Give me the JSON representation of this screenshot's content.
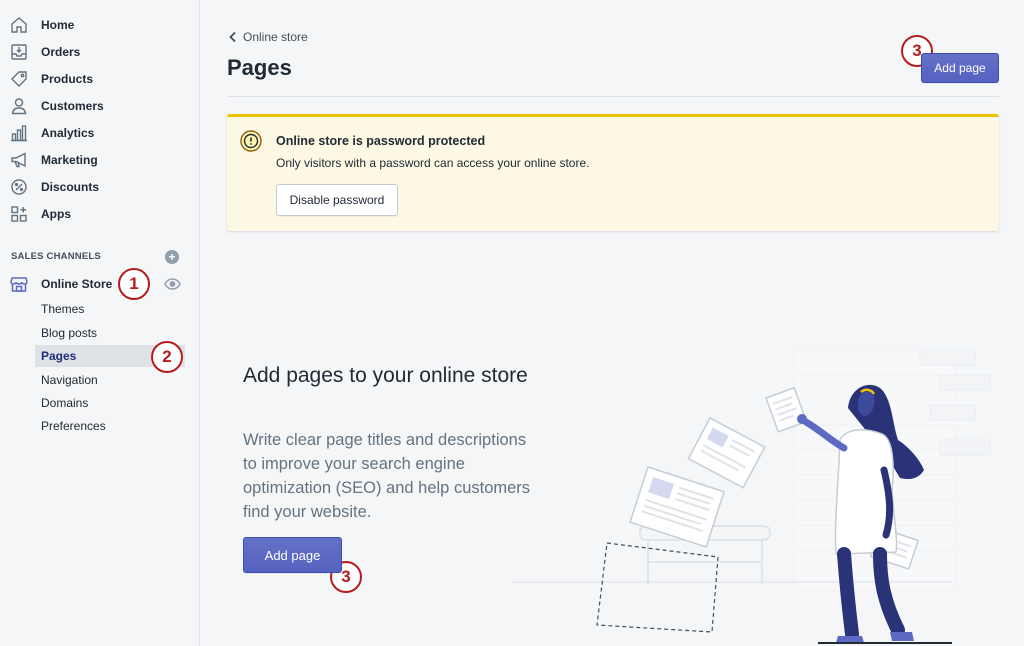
{
  "sidebar": {
    "items": [
      {
        "label": "Home",
        "icon": "home-icon"
      },
      {
        "label": "Orders",
        "icon": "orders-icon"
      },
      {
        "label": "Products",
        "icon": "tag-icon"
      },
      {
        "label": "Customers",
        "icon": "person-icon"
      },
      {
        "label": "Analytics",
        "icon": "bar-chart-icon"
      },
      {
        "label": "Marketing",
        "icon": "megaphone-icon"
      },
      {
        "label": "Discounts",
        "icon": "discount-icon"
      },
      {
        "label": "Apps",
        "icon": "apps-icon"
      }
    ],
    "section_title": "SALES CHANNELS",
    "add_channel": "+",
    "channel": {
      "label": "Online Store",
      "icon": "store-icon"
    },
    "sub_items": [
      {
        "label": "Themes"
      },
      {
        "label": "Blog posts"
      },
      {
        "label": "Pages",
        "active": true
      },
      {
        "label": "Navigation"
      },
      {
        "label": "Domains"
      },
      {
        "label": "Preferences"
      }
    ]
  },
  "header": {
    "breadcrumb": "Online store",
    "title": "Pages",
    "primary_action": "Add page"
  },
  "banner": {
    "title": "Online store is password protected",
    "text": "Only visitors with a password can access your online store.",
    "action": "Disable password"
  },
  "empty_state": {
    "title": "Add pages to your online store",
    "text": "Write clear page titles and descriptions to improve your search engine optimization (SEO) and help customers find your website.",
    "action": "Add page"
  },
  "annotations": {
    "one": "1",
    "two": "2",
    "three": "3"
  },
  "colors": {
    "primary": "#5c6ac4",
    "badge": "#b71c1c",
    "banner_bg": "#fcf8e3",
    "banner_accent": "#eec200"
  }
}
